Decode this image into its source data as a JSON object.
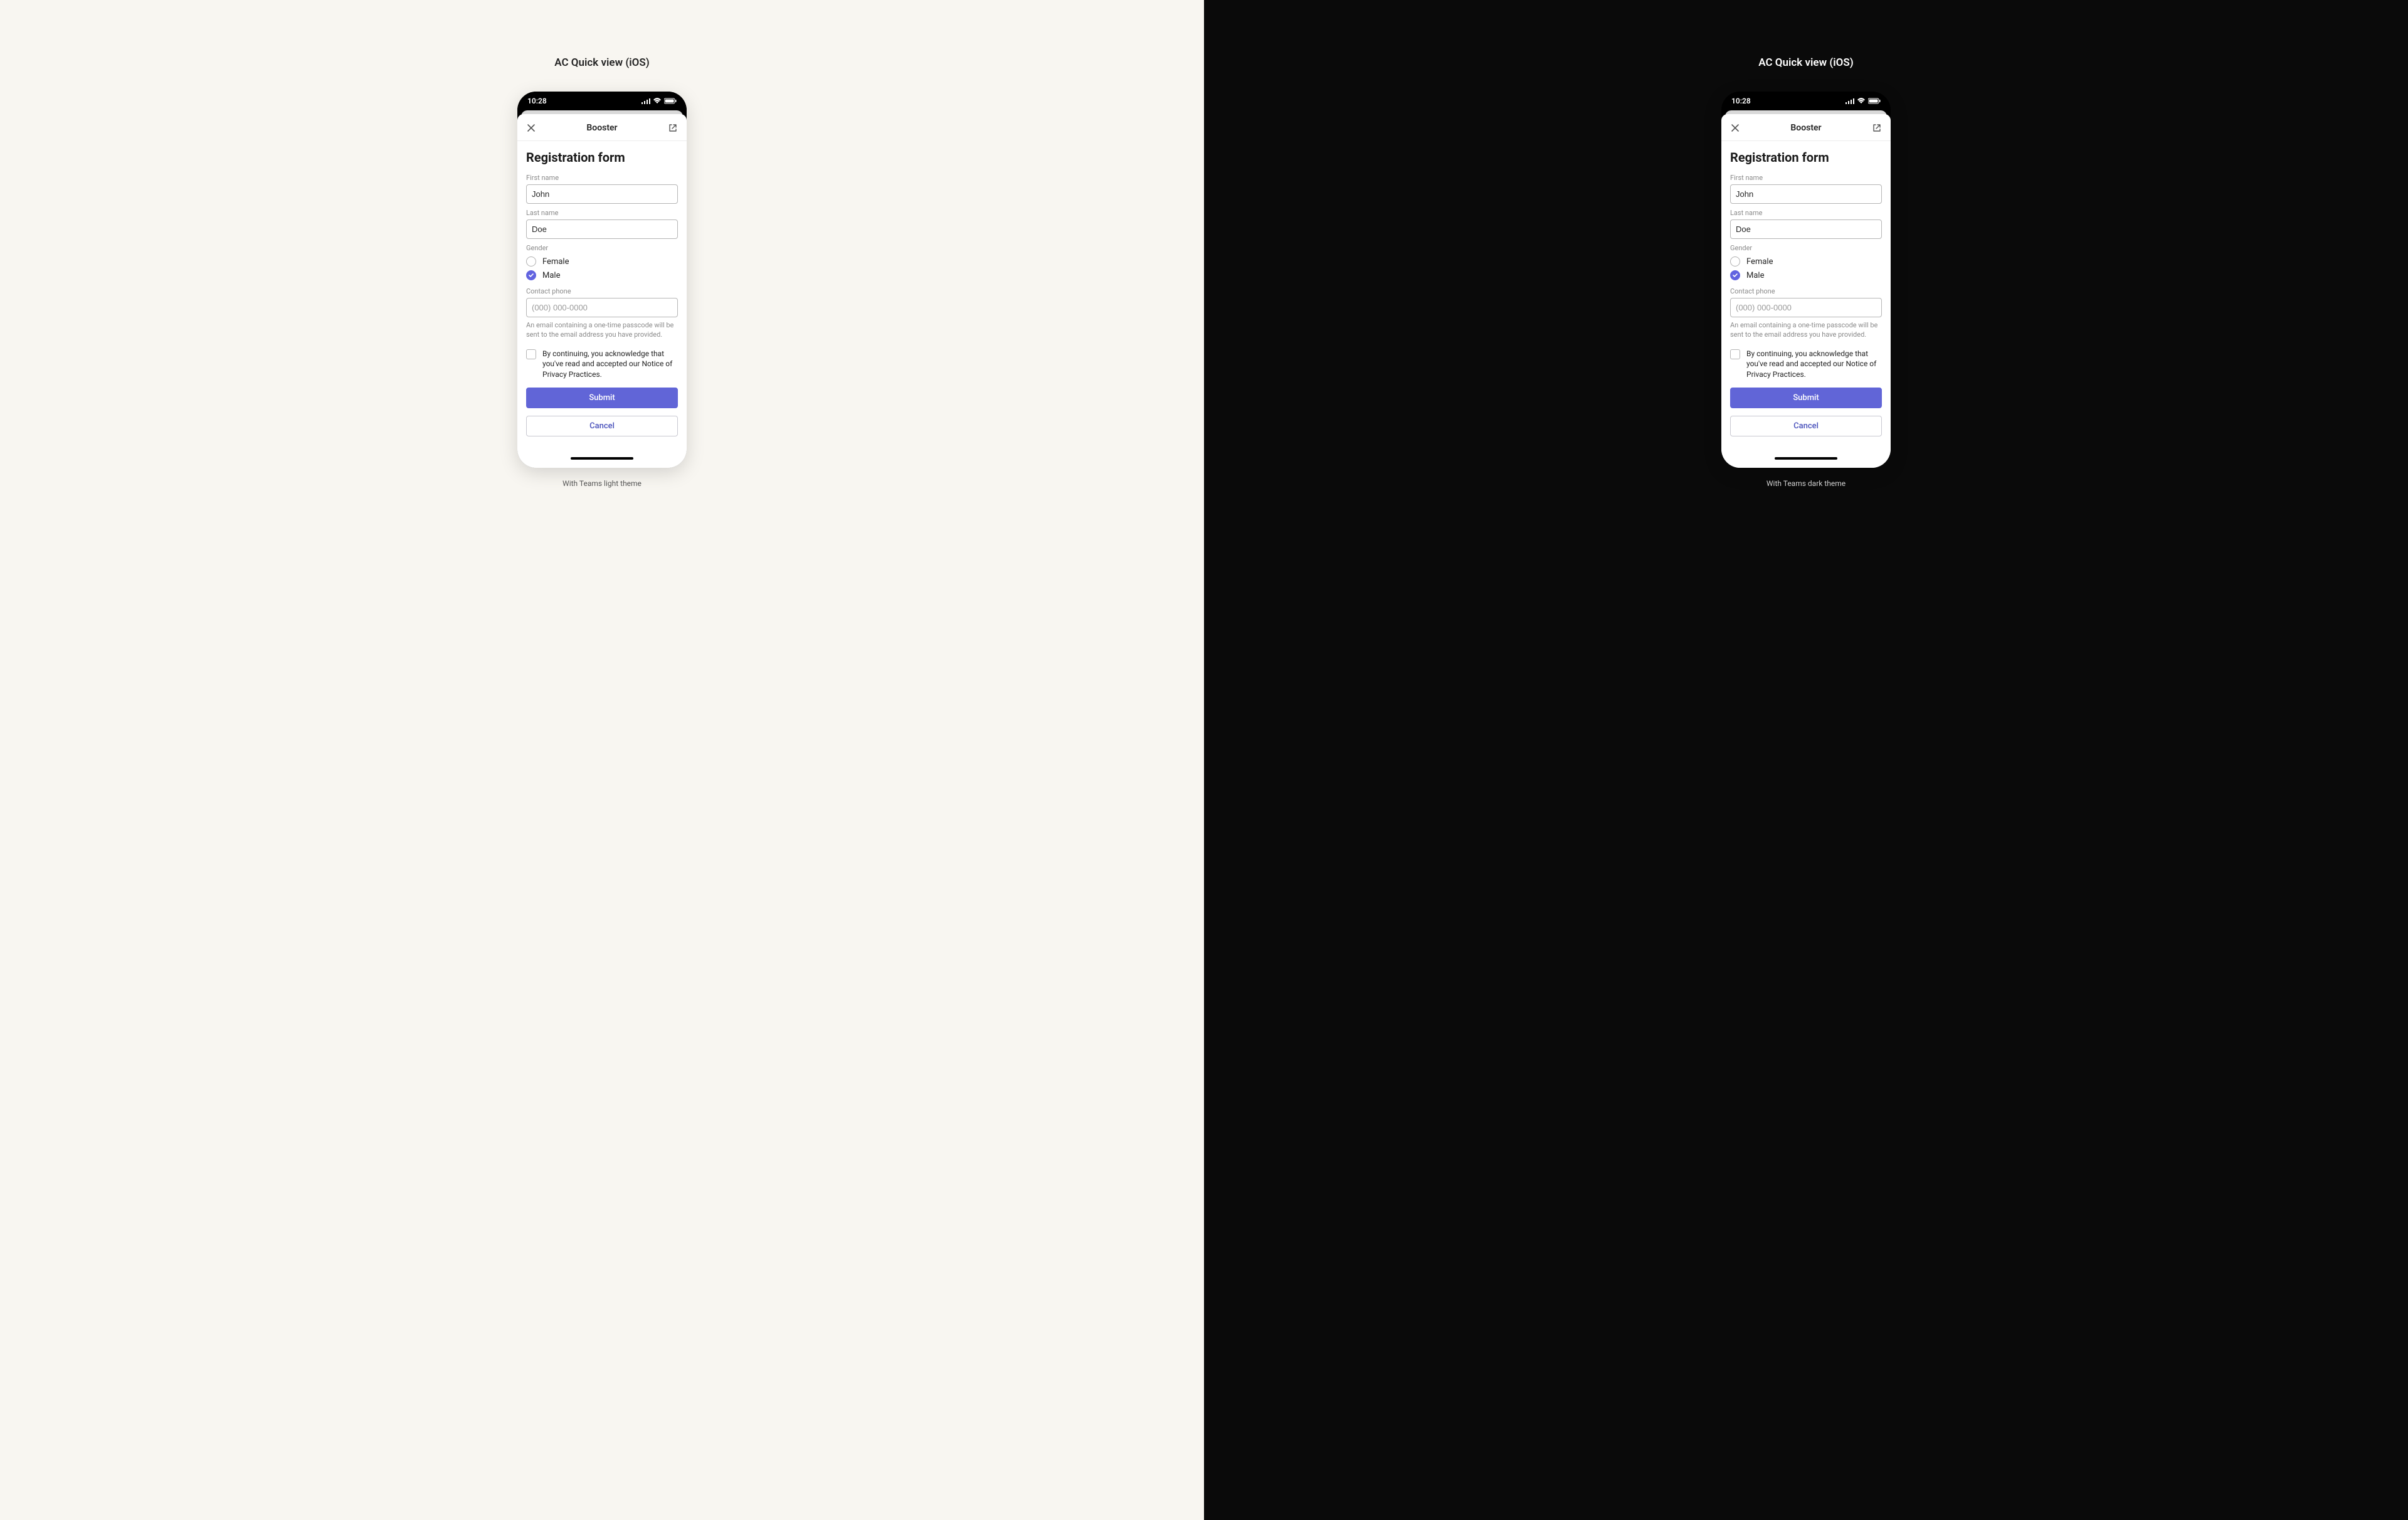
{
  "colors": {
    "accent": "#6165d7",
    "light_bg": "#f8f6f1",
    "dark_bg": "#0a0a0a"
  },
  "light": {
    "panel_title": "AC Quick view (iOS)",
    "caption": "With Teams light theme",
    "status": {
      "time": "10:28"
    },
    "sheet": {
      "close_icon": "close-icon",
      "title": "Booster",
      "open_icon": "open-external-icon"
    },
    "form": {
      "title": "Registration form",
      "first_name": {
        "label": "First name",
        "value": "John"
      },
      "last_name": {
        "label": "Last name",
        "value": "Doe"
      },
      "gender": {
        "label": "Gender",
        "options": [
          {
            "label": "Female",
            "checked": false
          },
          {
            "label": "Male",
            "checked": true
          }
        ]
      },
      "phone": {
        "label": "Contact phone",
        "placeholder": "(000) 000-0000",
        "helper": "An email containing a one-time passcode will be sent to the email address you have provided."
      },
      "consent": {
        "checked": false,
        "text": "By continuing, you acknowledge that you've read and accepted our Notice of Privacy Practices."
      },
      "submit_label": "Submit",
      "cancel_label": "Cancel"
    }
  },
  "dark": {
    "panel_title": "AC Quick view (iOS)",
    "caption": "With Teams dark theme",
    "status": {
      "time": "10:28"
    },
    "sheet": {
      "close_icon": "close-icon",
      "title": "Booster",
      "open_icon": "open-external-icon"
    },
    "form": {
      "title": "Registration form",
      "first_name": {
        "label": "First name",
        "value": "John"
      },
      "last_name": {
        "label": "Last name",
        "value": "Doe"
      },
      "gender": {
        "label": "Gender",
        "options": [
          {
            "label": "Female",
            "checked": false
          },
          {
            "label": "Male",
            "checked": true
          }
        ]
      },
      "phone": {
        "label": "Contact phone",
        "placeholder": "(000) 000-0000",
        "helper": "An email containing a one-time passcode will be sent to the email address you have provided."
      },
      "consent": {
        "checked": false,
        "text": "By continuing, you acknowledge that you've read and accepted our Notice of Privacy Practices."
      },
      "submit_label": "Submit",
      "cancel_label": "Cancel"
    }
  }
}
